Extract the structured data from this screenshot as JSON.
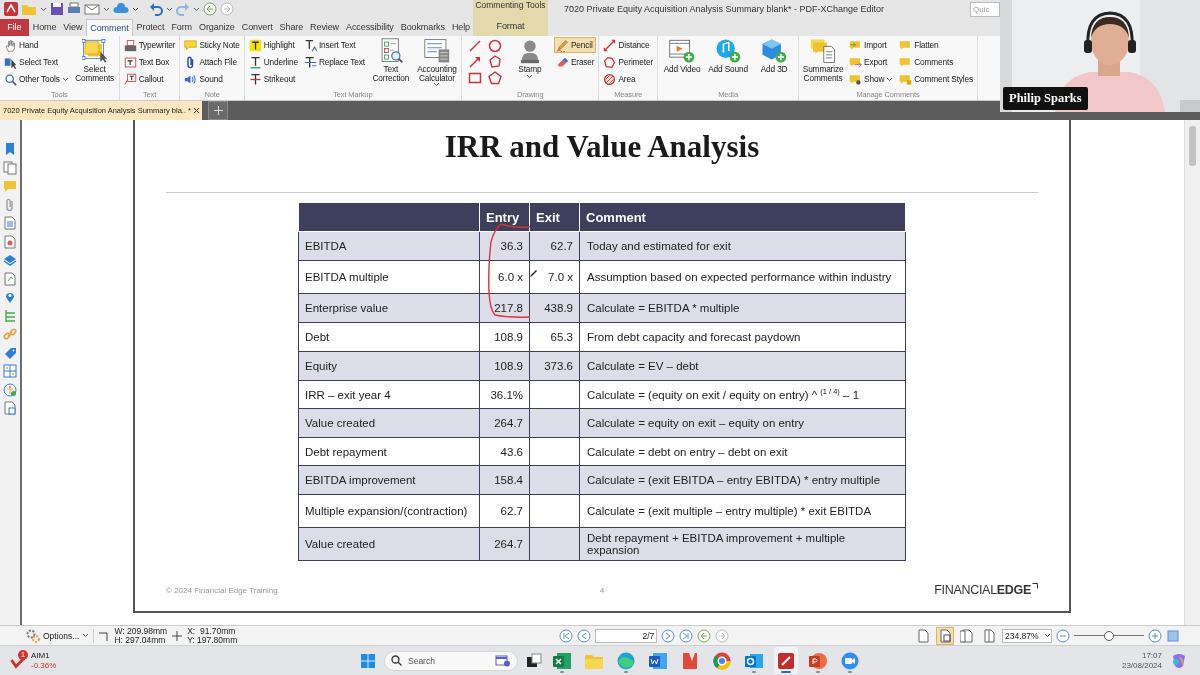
{
  "title_bar": {
    "title": "7020 Private Equity Acquisition Analysis Summary blank* - PDF-XChange Editor",
    "search_placeholder": "Quic",
    "context_group": "Commenting Tools"
  },
  "tabs": [
    {
      "label": "File",
      "kind": "file",
      "selected": false
    },
    {
      "label": "Home",
      "kind": "main",
      "selected": false
    },
    {
      "label": "View",
      "kind": "main",
      "selected": false
    },
    {
      "label": "Comment",
      "kind": "main",
      "selected": true
    },
    {
      "label": "Protect",
      "kind": "main",
      "selected": false
    },
    {
      "label": "Form",
      "kind": "main",
      "selected": false
    },
    {
      "label": "Organize",
      "kind": "main",
      "selected": false
    },
    {
      "label": "Convert",
      "kind": "main",
      "selected": false
    },
    {
      "label": "Share",
      "kind": "main",
      "selected": false
    },
    {
      "label": "Review",
      "kind": "main",
      "selected": false
    },
    {
      "label": "Accessibility",
      "kind": "main",
      "selected": false
    },
    {
      "label": "Bookmarks",
      "kind": "main",
      "selected": false
    },
    {
      "label": "Help",
      "kind": "main",
      "selected": false
    },
    {
      "label": "Format",
      "kind": "contextual",
      "selected": false
    }
  ],
  "ribbon": {
    "groups": [
      {
        "label": "Tools",
        "items": [
          {
            "kind": "small",
            "label": "Hand",
            "menu": false
          },
          {
            "kind": "small",
            "label": "Select Text",
            "menu": false
          },
          {
            "kind": "small",
            "label": "Other Tools",
            "menu": true
          },
          {
            "kind": "large",
            "label": "Select Comments",
            "menu": false
          }
        ]
      },
      {
        "label": "Text",
        "items": [
          {
            "kind": "small",
            "label": "Typewriter",
            "menu": false
          },
          {
            "kind": "small",
            "label": "Text Box",
            "menu": false
          },
          {
            "kind": "small",
            "label": "Callout",
            "menu": false
          }
        ]
      },
      {
        "label": "Note",
        "items": [
          {
            "kind": "small",
            "label": "Sticky Note",
            "menu": false
          },
          {
            "kind": "small",
            "label": "Attach File",
            "menu": false
          },
          {
            "kind": "small",
            "label": "Sound",
            "menu": false
          }
        ]
      },
      {
        "label": "Text Markup",
        "items": [
          {
            "kind": "small",
            "label": "Highlight",
            "menu": false
          },
          {
            "kind": "small",
            "label": "Underline",
            "menu": false
          },
          {
            "kind": "small",
            "label": "Strikeout",
            "menu": false
          },
          {
            "kind": "small",
            "label": "Insert Text",
            "menu": false
          },
          {
            "kind": "small",
            "label": "Replace Text",
            "menu": false
          },
          {
            "kind": "large",
            "label": "Text Correction",
            "menu": false
          },
          {
            "kind": "large",
            "label": "Accounting Calculator",
            "menu": true
          }
        ]
      },
      {
        "label": "Drawing",
        "items": [
          {
            "kind": "shapes",
            "active": false
          },
          {
            "kind": "large",
            "label": "Stamp",
            "menu": true,
            "active": false
          },
          {
            "kind": "small",
            "label": "Pencil",
            "menu": false,
            "active": true
          },
          {
            "kind": "small",
            "label": "Eraser",
            "menu": false,
            "active": false
          }
        ]
      },
      {
        "label": "Measure",
        "items": [
          {
            "kind": "small",
            "label": "Distance",
            "menu": false
          },
          {
            "kind": "small",
            "label": "Perimeter",
            "menu": false
          },
          {
            "kind": "small",
            "label": "Area",
            "menu": false
          }
        ]
      },
      {
        "label": "Media",
        "items": [
          {
            "kind": "large",
            "label": "Add Video",
            "menu": false
          },
          {
            "kind": "large",
            "label": "Add Sound",
            "menu": false
          },
          {
            "kind": "large",
            "label": "Add 3D",
            "menu": false
          }
        ]
      },
      {
        "label": "Manage Comments",
        "items": [
          {
            "kind": "large",
            "label": "Summarize Comments",
            "menu": false
          },
          {
            "kind": "small",
            "label": "Import",
            "menu": false
          },
          {
            "kind": "small",
            "label": "Export",
            "menu": false
          },
          {
            "kind": "small",
            "label": "Show",
            "menu": true
          },
          {
            "kind": "small",
            "label": "Flatten",
            "menu": false
          },
          {
            "kind": "small",
            "label": "Comments",
            "menu": false
          },
          {
            "kind": "small",
            "label": "Comment Styles",
            "menu": false
          }
        ]
      }
    ]
  },
  "document_tab": {
    "title": "7020 Private Equity Acquisition Analysis Summary bla.. *"
  },
  "page": {
    "title": "IRR and Value Analysis",
    "table": {
      "columns": [
        "Entry",
        "Exit",
        "Comment"
      ],
      "rows": [
        {
          "label": "EBITDA",
          "entry": "36.3",
          "exit": "62.7",
          "comment": "Today and estimated for exit"
        },
        {
          "label": "EBITDA multiple",
          "entry": "6.0 x",
          "exit": "7.0 x",
          "comment": "Assumption based on expected performance within industry"
        },
        {
          "label": "Enterprise value",
          "entry": "217.8",
          "exit": "438.9",
          "comment": "Calculate = EBITDA * multiple"
        },
        {
          "label": "Debt",
          "entry": "108.9",
          "exit": "65.3",
          "comment": "From debt capacity and forecast paydown"
        },
        {
          "label": "Equity",
          "entry": "108.9",
          "exit": "373.6",
          "comment": "Calculate = EV – debt"
        },
        {
          "label": "IRR – exit year 4",
          "entry": "36.1%",
          "comment": "Calculate = (equity on exit / equity on entry) ^ $^{(1 / 4)}$ – 1"
        },
        {
          "label": "Value created",
          "entry": "264.7",
          "comment": "Calculate = equity on exit – equity on entry"
        },
        {
          "label": "Debt repayment",
          "entry": "43.6",
          "comment": "Calculate = debt on entry – debt on exit"
        },
        {
          "label": "EBITDA improvement",
          "entry": "158.4",
          "comment": "Calculate = (exit EBITDA – entry EBITDA) * entry multiple"
        },
        {
          "label": "Multiple expansion/(contraction)",
          "entry": "62.7",
          "comment": "Calculate = (exit multiple – entry multiple) * exit EBITDA"
        },
        {
          "label": "Value created",
          "entry": "264.7",
          "comment": "Debt repayment + EBITDA improvement + multiple expansion"
        }
      ]
    },
    "footer": {
      "copyright": "© 2024 Financial Edge Training",
      "page_number": "4",
      "logo": "FINANCIAL**EDGE**"
    }
  },
  "status_bar": {
    "options": "Options...",
    "width": "W: 209.98mm",
    "height": "H: 297.04mm",
    "x": "X:  91.70mm",
    "y": "Y: 197.80mm",
    "page": "2/7",
    "view_modes": [
      {
        "selected": false
      },
      {
        "selected": true
      },
      {
        "selected": false
      },
      {
        "selected": false
      }
    ],
    "zoom": "234.87%",
    "zoom_slider": {
      "level": 0.5
    }
  },
  "taskbar": {
    "stock": {
      "badge": "1",
      "name": "AIM1",
      "change": "-0.36%"
    },
    "search_placeholder": "Search",
    "apps": [
      {
        "kind": "spreadsheet",
        "running": true,
        "selected": false
      },
      {
        "kind": "folder",
        "running": false,
        "selected": false
      },
      {
        "kind": "browser-wave",
        "running": true,
        "selected": false
      },
      {
        "kind": "document",
        "running": false,
        "selected": false
      },
      {
        "kind": "red-book",
        "running": false,
        "selected": false
      },
      {
        "kind": "browser-ring",
        "running": false,
        "selected": false
      },
      {
        "kind": "mail",
        "running": true,
        "selected": false
      },
      {
        "kind": "pdf",
        "running": true,
        "selected": true
      },
      {
        "kind": "presentation",
        "running": true,
        "selected": false
      },
      {
        "kind": "video-call",
        "running": true,
        "selected": false
      }
    ],
    "time": "17:07",
    "date": "23/08/2024"
  },
  "video": {
    "name": "Philip Sparks"
  }
}
